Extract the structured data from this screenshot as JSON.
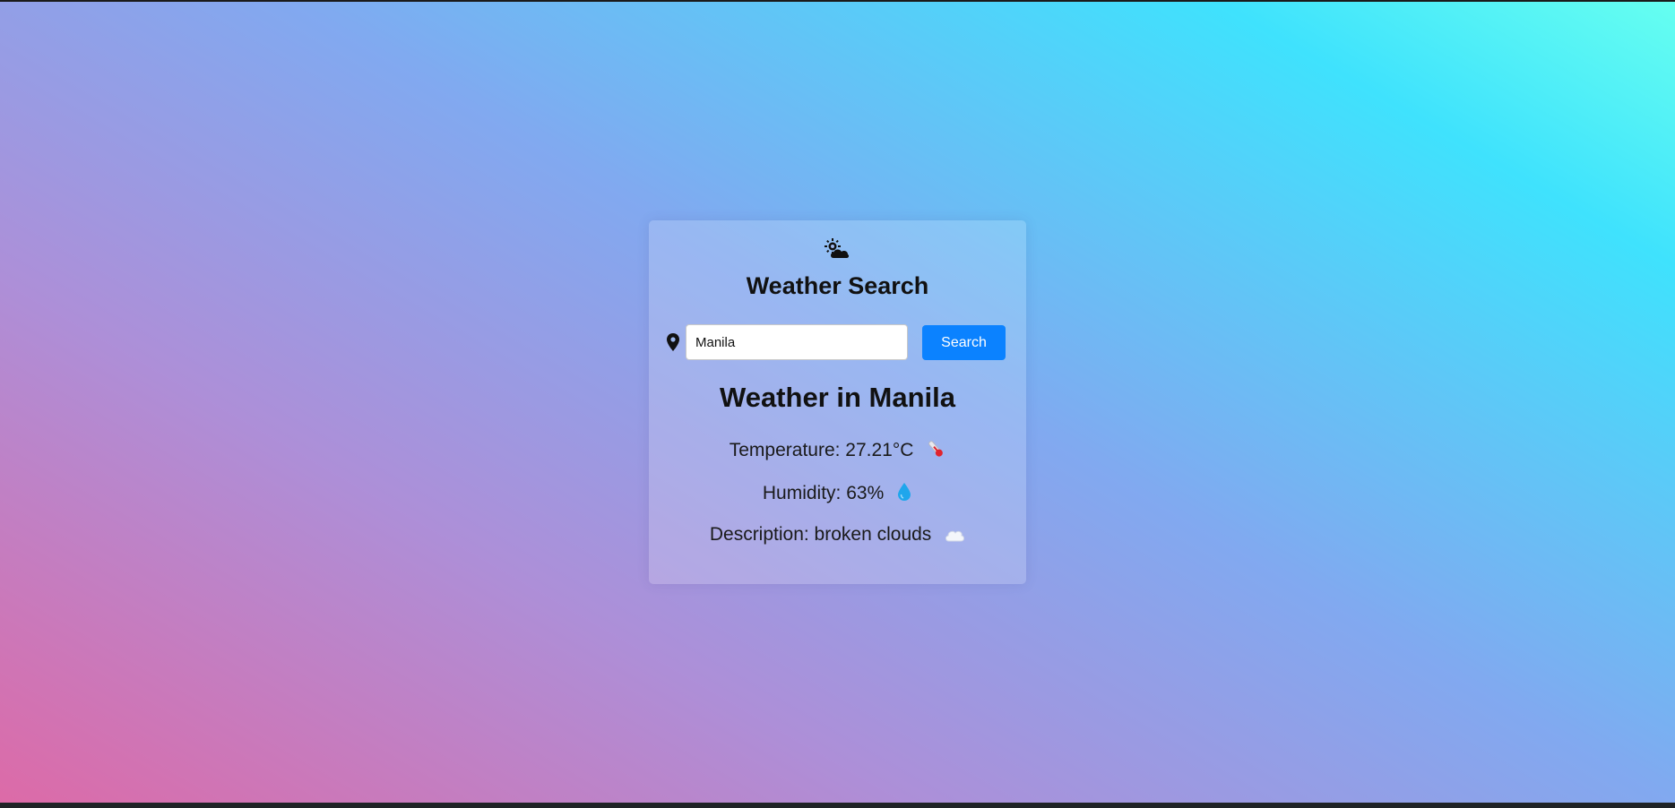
{
  "app": {
    "title": "Weather Search",
    "weather_icon": "sun-behind-cloud-icon"
  },
  "search": {
    "location_icon": "location-pin-icon",
    "input_value": "Manila",
    "button_label": "Search"
  },
  "result": {
    "heading": "Weather in Manila",
    "temperature_text": "Temperature: 27.21°C",
    "temperature_icon": "thermometer-icon",
    "humidity_text": "Humidity: 63%",
    "humidity_icon": "water-drop-icon",
    "description_text": "Description: broken clouds",
    "description_icon": "cloud-icon"
  },
  "colors": {
    "button": "#0b82ff",
    "gradient_start": "#dd6aa7",
    "gradient_mid": "#81a9f0",
    "gradient_end": "#66fff0"
  }
}
